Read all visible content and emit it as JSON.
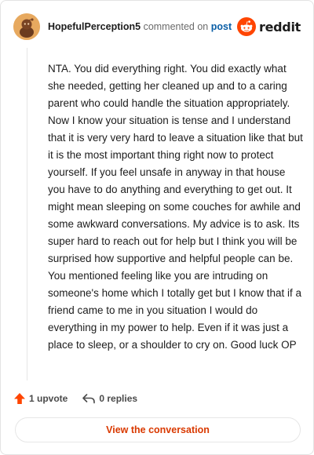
{
  "header": {
    "username": "HopefulPerception5",
    "commented_text": "commented on",
    "post_link": "post",
    "logo_text": "reddit"
  },
  "comment": {
    "body": "NTA. You did everything right. You did exactly what she needed, getting her cleaned up and to a caring parent who could handle the situation appropriately. Now I know your situation is tense and I understand that it is very very hard to leave a situation like that but it is the most important thing right now to protect yourself. If you feel unsafe in anyway in that house you have to do anything and everything to get out. It might mean sleeping on some couches for awhile and some awkward conversations. My advice is to ask. Its super hard to reach out for help but I think you will be surprised how supportive and helpful people can be. You mentioned feeling like you are intruding on someone's home which I totally get but I know that if a friend came to me in you situation I would do everything in my power to help. Even if it was just a place to sleep, or a shoulder to cry on. Good luck OP"
  },
  "actions": {
    "upvote_label": "1 upvote",
    "replies_label": "0 replies"
  },
  "footer": {
    "view_conversation_label": "View the conversation"
  },
  "colors": {
    "reddit_orange": "#ff4500",
    "link_blue": "#0a5ea6",
    "button_text": "#d93900",
    "avatar_bg": "#e7a95f"
  },
  "icons": {
    "avatar": "snoo-avatar-icon",
    "logo": "reddit-logo-icon",
    "upvote": "upvote-arrow-icon",
    "reply": "reply-arrow-icon"
  }
}
